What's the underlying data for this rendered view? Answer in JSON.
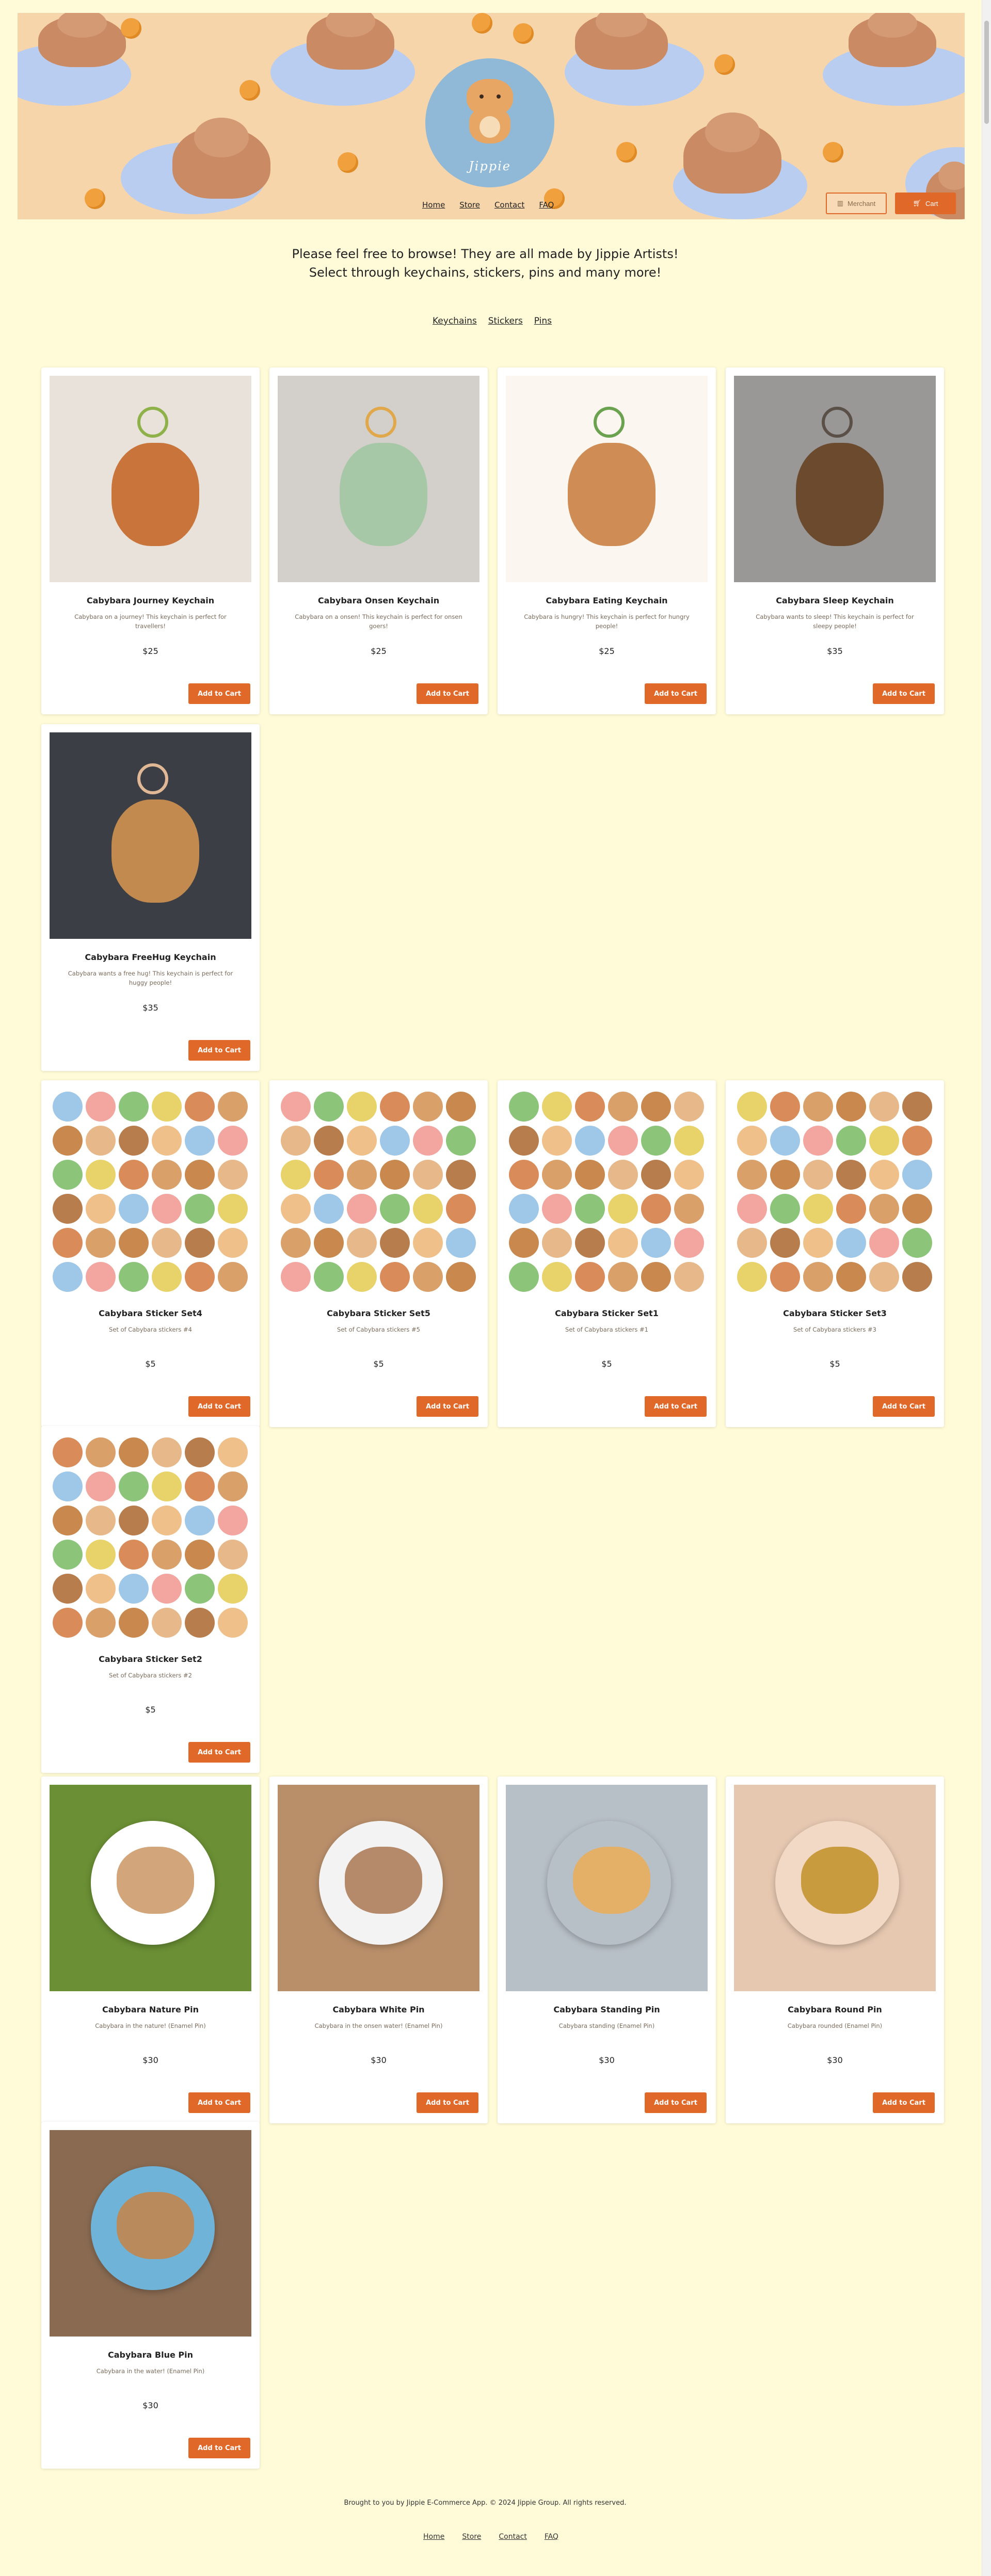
{
  "brand": {
    "logo_text": "Jippie"
  },
  "nav": {
    "home": "Home",
    "store": "Store",
    "contact": "Contact",
    "faq": "FAQ"
  },
  "header_buttons": {
    "merchant": "Merchant",
    "cart": "Cart"
  },
  "intro": {
    "line1": "Please feel free to browse! They are all made by Jippie Artists!",
    "line2": "Select through keychains, stickers, pins and many more!"
  },
  "categories": {
    "keychains": "Keychains",
    "stickers": "Stickers",
    "pins": "Pins"
  },
  "add_label": "Add to Cart",
  "products": [
    {
      "name": "Cabybara Journey Keychain",
      "desc": "Cabybara on a journey! This keychain is perfect for travellers!",
      "price": "$25"
    },
    {
      "name": "Cabybara Onsen Keychain",
      "desc": "Cabybara on a onsen! This keychain is perfect for onsen goers!",
      "price": "$25"
    },
    {
      "name": "Cabybara Eating Keychain",
      "desc": "Cabybara is hungry! This keychain is perfect for hungry people!",
      "price": "$25"
    },
    {
      "name": "Cabybara Sleep Keychain",
      "desc": "Cabybara wants to sleep! This keychain is perfect for sleepy people!",
      "price": "$35"
    },
    {
      "name": "Cabybara FreeHug Keychain",
      "desc": "Cabybara wants a free hug! This keychain is perfect for huggy people!",
      "price": "$35"
    },
    {
      "name": "Cabybara Sticker Set4",
      "desc": "Set of Cabybara stickers #4",
      "price": "$5"
    },
    {
      "name": "Cabybara Sticker Set5",
      "desc": "Set of Cabybara stickers #5",
      "price": "$5"
    },
    {
      "name": "Cabybara Sticker Set1",
      "desc": "Set of Cabybara stickers #1",
      "price": "$5"
    },
    {
      "name": "Cabybara Sticker Set3",
      "desc": "Set of Cabybara stickers #3",
      "price": "$5"
    },
    {
      "name": "Cabybara Sticker Set2",
      "desc": "Set of Cabybara stickers #2",
      "price": "$5"
    },
    {
      "name": "Cabybara Nature Pin",
      "desc": "Cabybara in the nature! (Enamel Pin)",
      "price": "$30"
    },
    {
      "name": "Cabybara White Pin",
      "desc": "Cabybara in the onsen water! (Enamel Pin)",
      "price": "$30"
    },
    {
      "name": "Cabybara Standing Pin",
      "desc": "Cabybara standing (Enamel Pin)",
      "price": "$30"
    },
    {
      "name": "Cabybara Round Pin",
      "desc": "Cabybara rounded (Enamel Pin)",
      "price": "$30"
    },
    {
      "name": "Cabybara Blue Pin",
      "desc": "Cabybara in the water! (Enamel Pin)",
      "price": "$30"
    }
  ],
  "footer": {
    "text": "Brought to you by Jippie E-Commerce App. © 2024 Jippie Group. All rights reserved.",
    "home": "Home",
    "store": "Store",
    "contact": "Contact",
    "faq": "FAQ"
  },
  "colors": {
    "accent": "#e0692a",
    "page_bg": "#fffbd8",
    "banner_bg": "#f7d5aa"
  }
}
